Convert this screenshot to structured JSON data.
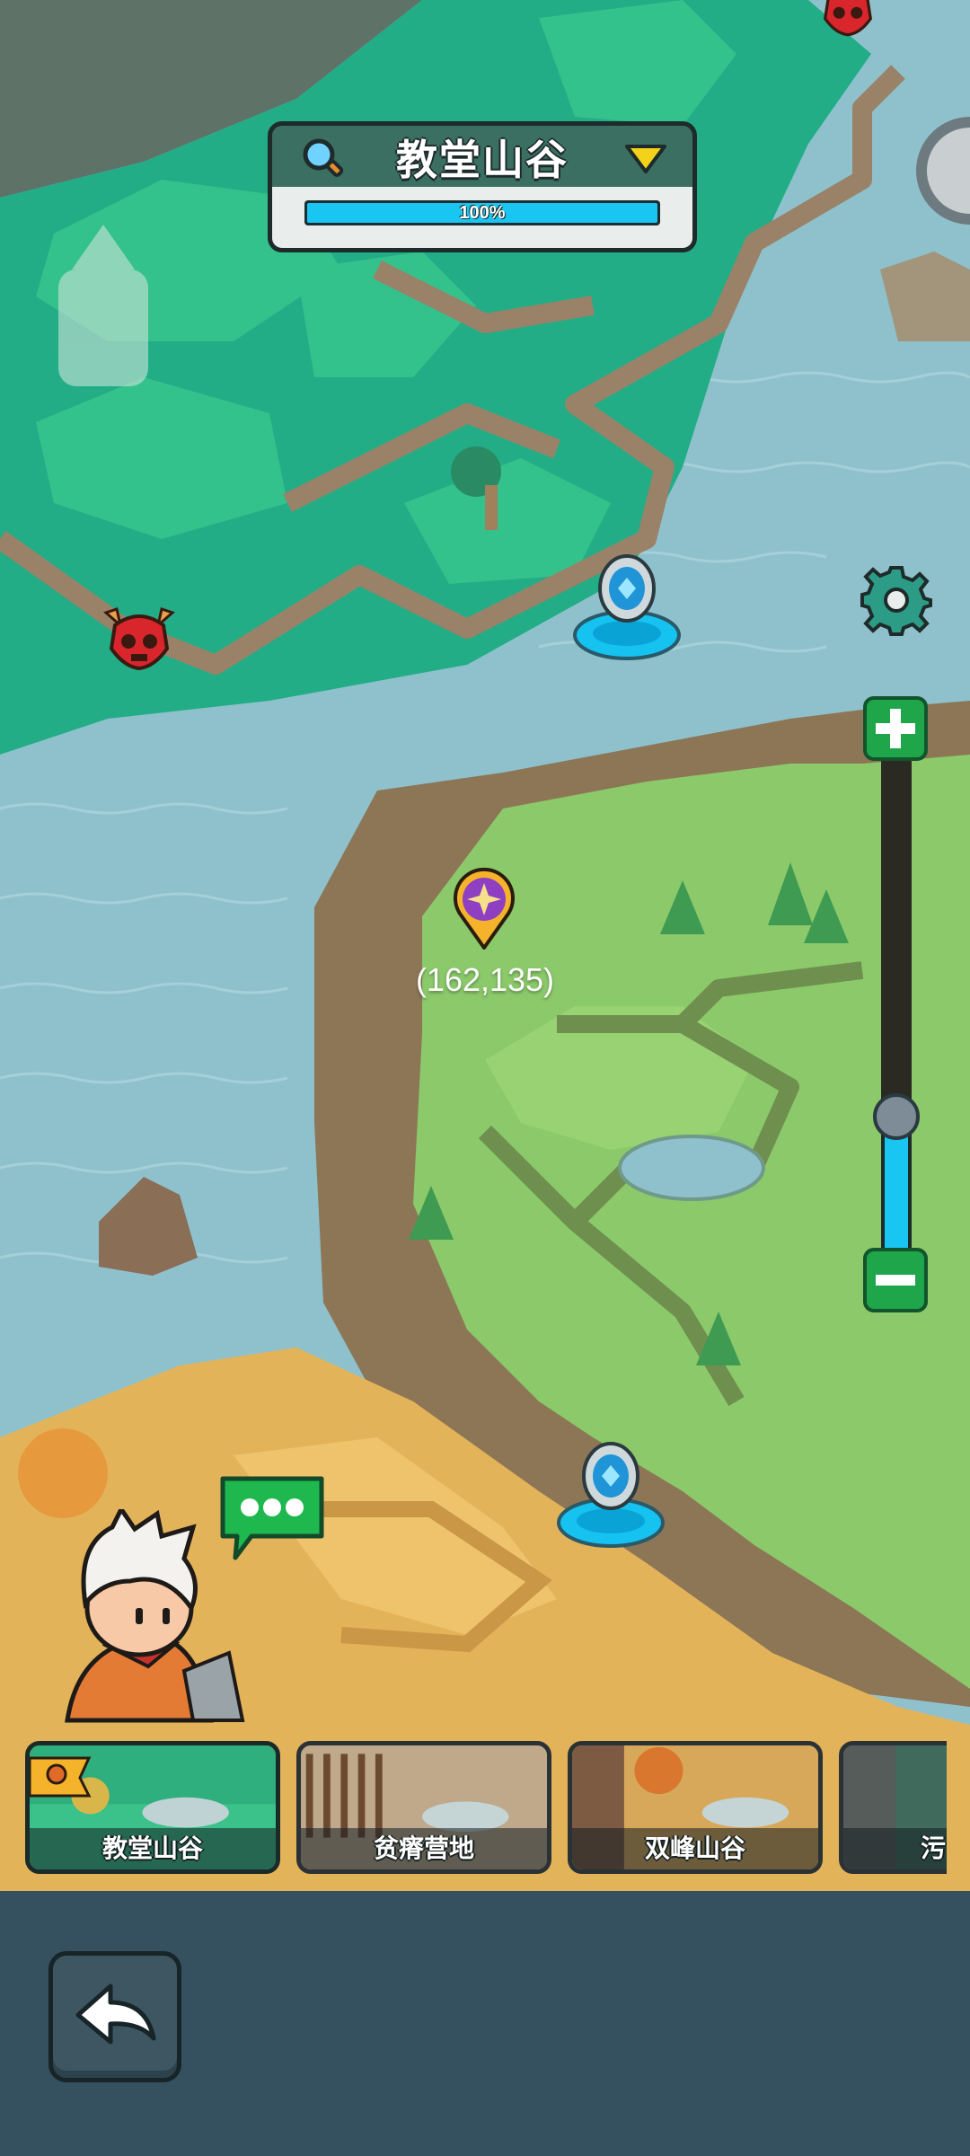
{
  "region": {
    "title": "教堂山谷",
    "progress_label": "100%",
    "progress": 1.0
  },
  "map": {
    "coordinate": "(162,135)"
  },
  "zoom": {
    "level": 0.28
  },
  "regions": [
    {
      "name": "教堂山谷",
      "selected": true
    },
    {
      "name": "贫瘠营地",
      "selected": false
    },
    {
      "name": "双峰山谷",
      "selected": false
    },
    {
      "name": "污",
      "selected": false
    }
  ],
  "icons": {
    "search": "search-icon",
    "dropdown": "chevron-down-icon",
    "settings": "gear-icon",
    "zoom_in": "plus-icon",
    "zoom_out": "minus-icon",
    "back": "back-arrow-icon",
    "enemy": "demon-skull-icon",
    "waypoint": "portal-icon",
    "location": "location-pin-icon",
    "speech": "speech-bubble-icon"
  },
  "colors": {
    "water": "#8fc1cc",
    "grass_dark": "#2bb38a",
    "grass_light": "#8bc96a",
    "sand": "#e3b35a",
    "progress": "#19c6f2",
    "button_green": "#1fa64a"
  }
}
